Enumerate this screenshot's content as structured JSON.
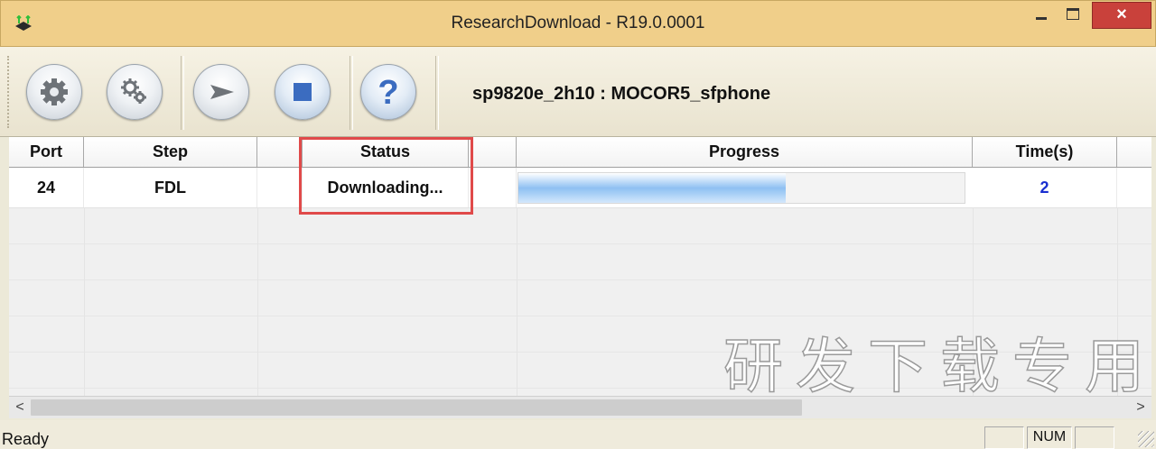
{
  "window": {
    "title": "ResearchDownload - R19.0.0001",
    "close_label": "×",
    "icon": "app-icon"
  },
  "toolbar": {
    "buttons": [
      {
        "name": "load-packet-button",
        "icon": "gear-icon"
      },
      {
        "name": "settings-button",
        "icon": "gears-icon"
      },
      {
        "name": "start-download-button",
        "icon": "play-icon"
      },
      {
        "name": "stop-download-button",
        "icon": "stop-icon"
      },
      {
        "name": "help-button",
        "icon": "question-icon",
        "glyph": "?"
      }
    ],
    "device_label": "sp9820e_2h10 : MOCOR5_sfphone"
  },
  "grid": {
    "columns": [
      "Port",
      "Step",
      "",
      "Status",
      "",
      "Progress",
      "Time(s)",
      ""
    ],
    "rows": [
      {
        "port": "24",
        "step": "FDL",
        "status": "Downloading...",
        "progress": 0.6,
        "time": "2"
      }
    ],
    "watermark": "研发下载专用"
  },
  "scrollbar": {
    "left_arrow": "<",
    "right_arrow": ">"
  },
  "statusbar": {
    "text": "Ready",
    "panels": [
      "",
      "NUM",
      ""
    ]
  },
  "colors": {
    "titlebar": "#f0cf8a",
    "close_button": "#c9413b",
    "highlight": "#e04a4a",
    "time_value": "#1a2fd0",
    "progress_fill": "#8fc0f2"
  }
}
